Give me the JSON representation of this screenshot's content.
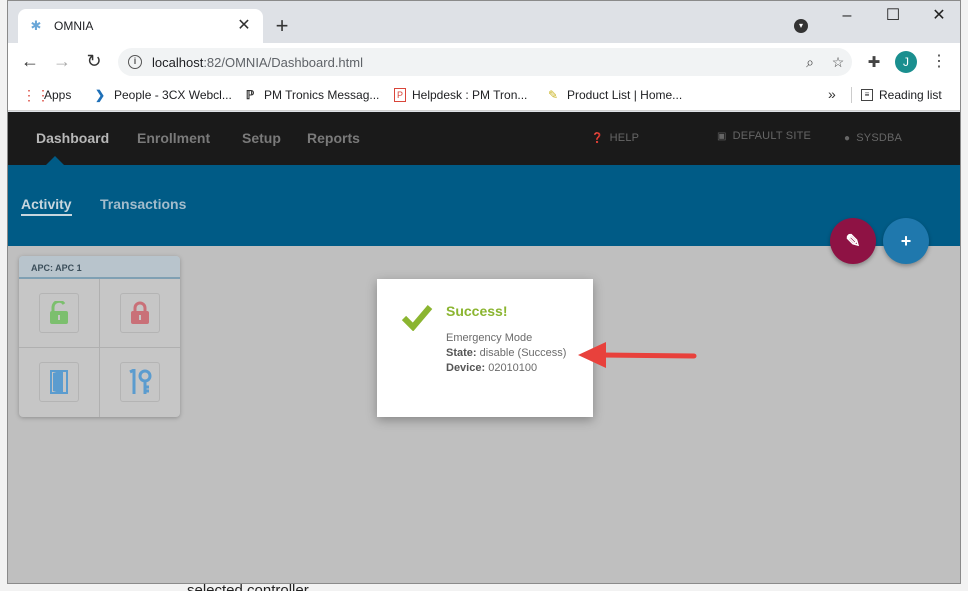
{
  "browser": {
    "tab_title": "OMNIA",
    "url_host": "localhost",
    "url_path": ":82/OMNIA/Dashboard.html",
    "bookmarks": [
      {
        "label": "Apps",
        "icon": "apps-grid-icon"
      },
      {
        "label": "People - 3CX Webcl...",
        "icon": "3cx-icon"
      },
      {
        "label": "PM Tronics Messag...",
        "icon": "pmtronics-icon"
      },
      {
        "label": "Helpdesk : PM Tron...",
        "icon": "helpdesk-icon"
      },
      {
        "label": "Product List | Home...",
        "icon": "note-icon"
      }
    ],
    "reading_list": "Reading list",
    "avatar_letter": "J"
  },
  "app": {
    "nav": [
      {
        "label": "Dashboard"
      },
      {
        "label": "Enrollment"
      },
      {
        "label": "Setup"
      },
      {
        "label": "Reports"
      }
    ],
    "help": "HELP",
    "site": "DEFAULT SITE",
    "user": "SYSDBA",
    "subtabs": [
      {
        "label": "Activity"
      },
      {
        "label": "Transactions"
      }
    ],
    "card": {
      "title": "APC: APC 1"
    },
    "colors": {
      "nav_bg": "#1a1a1a",
      "subnav_bg": "#005b86",
      "edit_fab": "#8e1244",
      "add_fab": "#1f78ad",
      "success": "#8bb530"
    }
  },
  "dialog": {
    "title": "Success!",
    "line1": "Emergency Mode",
    "state_label": "State:",
    "state_value": "disable (Success)",
    "device_label": "Device:",
    "device_value": "02010100"
  },
  "footer_text": "selected controller"
}
